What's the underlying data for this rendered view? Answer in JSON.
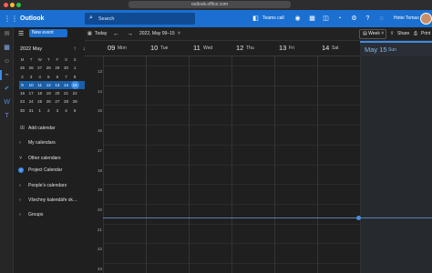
{
  "browser": {
    "url": "outlook.office.com"
  },
  "header": {
    "app_name": "Outlook",
    "search_placeholder": "Search",
    "teams_call_label": "Teams call",
    "user_name": "Hotei Tomas",
    "icons": [
      "waffle-icon",
      "search-icon",
      "teams-icon",
      "calendar-icon",
      "bell-icon",
      "settings-icon",
      "help-icon",
      "lightbulb-icon"
    ]
  },
  "rail": {
    "icons": [
      "mail-icon",
      "calendar-icon",
      "people-icon",
      "attach-icon",
      "todo-icon",
      "word-icon",
      "teams-icon"
    ]
  },
  "panel": {
    "new_event_label": "New event",
    "mini_calendar": {
      "title": "2022 May",
      "weekdays": [
        "M",
        "T",
        "W",
        "T",
        "F",
        "S",
        "S"
      ],
      "weeks": [
        [
          "25",
          "26",
          "27",
          "28",
          "29",
          "30",
          "1"
        ],
        [
          "2",
          "3",
          "4",
          "5",
          "6",
          "7",
          "8"
        ],
        [
          "9",
          "10",
          "11",
          "12",
          "13",
          "14",
          "15"
        ],
        [
          "16",
          "17",
          "18",
          "19",
          "20",
          "21",
          "22"
        ],
        [
          "23",
          "24",
          "25",
          "26",
          "27",
          "28",
          "29"
        ],
        [
          "30",
          "31",
          "1",
          "2",
          "3",
          "4",
          "5"
        ]
      ],
      "selected_week_index": 2,
      "today": "15"
    },
    "add_calendar_label": "Add calendar",
    "nav": [
      {
        "label": "My calendars",
        "chevron": "›"
      },
      {
        "label": "Other calendars",
        "chevron": "˅"
      },
      {
        "label": "Project Calendar",
        "chevron": "✓"
      },
      {
        "label": "People's calendars",
        "chevron": "›"
      },
      {
        "label": "Všechny kalendáře sk…",
        "chevron": "›"
      },
      {
        "label": "Groups",
        "chevron": "›"
      }
    ]
  },
  "toolbar": {
    "today_label": "Today",
    "range_label": "2022, May 09–15",
    "view_label": "Week",
    "share_label": "Share",
    "print_label": "Print"
  },
  "calendar": {
    "days": [
      {
        "num": "09",
        "name": "Mon"
      },
      {
        "num": "10",
        "name": "Tue"
      },
      {
        "num": "11",
        "name": "Wed"
      },
      {
        "num": "12",
        "name": "Thu"
      },
      {
        "num": "13",
        "name": "Fri"
      },
      {
        "num": "14",
        "name": "Sat"
      },
      {
        "num": "May 15",
        "name": "Sun"
      }
    ],
    "today_index": 6,
    "hours": [
      "13",
      "14",
      "15",
      "16",
      "17",
      "18",
      "19",
      "20",
      "21",
      "22",
      "23"
    ]
  },
  "colors": {
    "accent": "#1a6fd1",
    "today_highlight": "#3b8be8",
    "background": "#1f1f1f"
  }
}
